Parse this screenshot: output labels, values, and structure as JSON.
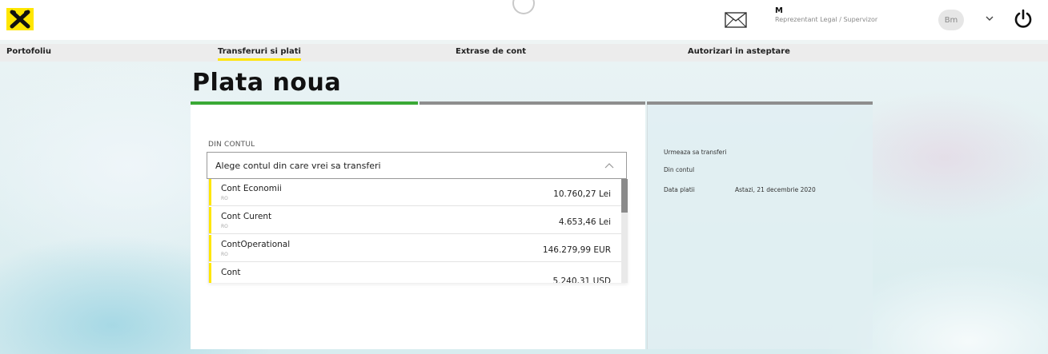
{
  "header": {
    "user_initial": "M",
    "user_role": "Reprezentant Legal / Supervizor",
    "company_avatar_text": "Bm"
  },
  "nav": {
    "items": [
      {
        "label": "Portofoliu",
        "active": false
      },
      {
        "label": "Transferuri si plati",
        "active": true
      },
      {
        "label": "Extrase de cont",
        "active": false
      },
      {
        "label": "Autorizari in asteptare",
        "active": false
      }
    ]
  },
  "page": {
    "title": "Plata noua"
  },
  "form": {
    "section_label": "DIN CONTUL",
    "select_placeholder": "Alege contul din care vrei sa transferi",
    "accounts": [
      {
        "name": "Cont Economii",
        "iban": "RO",
        "amount": "10.760,27 Lei"
      },
      {
        "name": "Cont Curent",
        "iban": "RO",
        "amount": "4.653,46 Lei"
      },
      {
        "name": "ContOperational",
        "iban": "RO",
        "amount": "146.279,99 EUR"
      },
      {
        "name": "Cont",
        "iban": "",
        "amount": "5.240,31 USD"
      }
    ]
  },
  "summary": {
    "title": "Urmeaza sa transferi",
    "from_label": "Din contul",
    "date_label": "Data platii",
    "date_value": "Astazi, 21 decembrie 2020"
  },
  "colors": {
    "brand_yellow": "#ffe600",
    "step_active": "#3aa935",
    "step_inactive": "#8e8e8e"
  },
  "icons": {
    "logo": "raiffeisen-logo",
    "mail": "envelope-icon",
    "power": "power-icon",
    "chevron": "chevron-down-icon"
  }
}
